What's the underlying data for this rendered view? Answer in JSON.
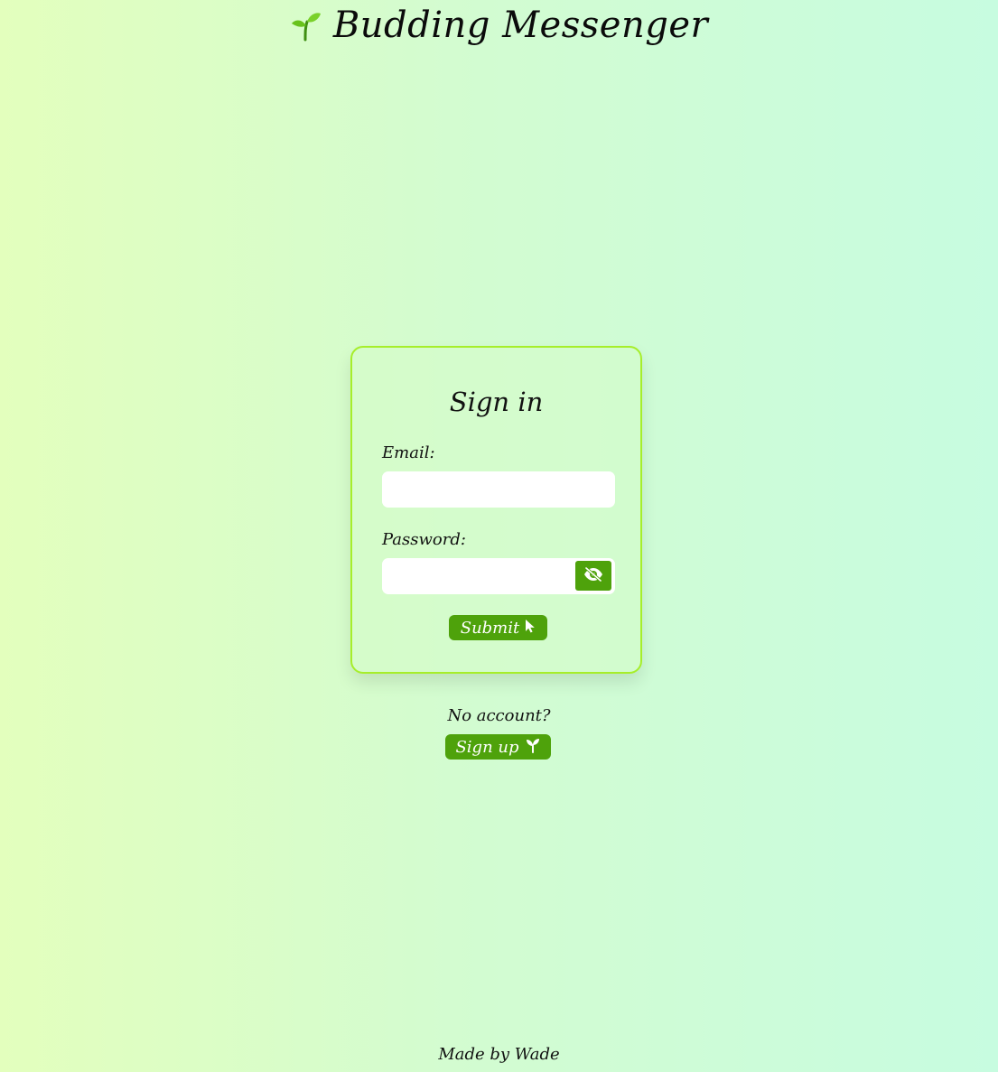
{
  "header": {
    "logo_icon": "sprout-icon",
    "title": "Budding Messenger"
  },
  "signin_card": {
    "title": "Sign in",
    "email_label": "Email:",
    "email_value": "",
    "password_label": "Password:",
    "password_value": "",
    "toggle_icon": "eye-slash-icon",
    "submit_label": "Submit",
    "submit_icon": "cursor-pointer-icon"
  },
  "signup": {
    "prompt": "No account?",
    "button_label": "Sign up",
    "button_icon": "sprout-icon"
  },
  "footer": {
    "credit": "Made by Wade"
  },
  "colors": {
    "accent": "#4ea20b",
    "card_border": "#a6ee2a",
    "bg_left": "#e3ffbd",
    "bg_right": "#c7fce0"
  }
}
